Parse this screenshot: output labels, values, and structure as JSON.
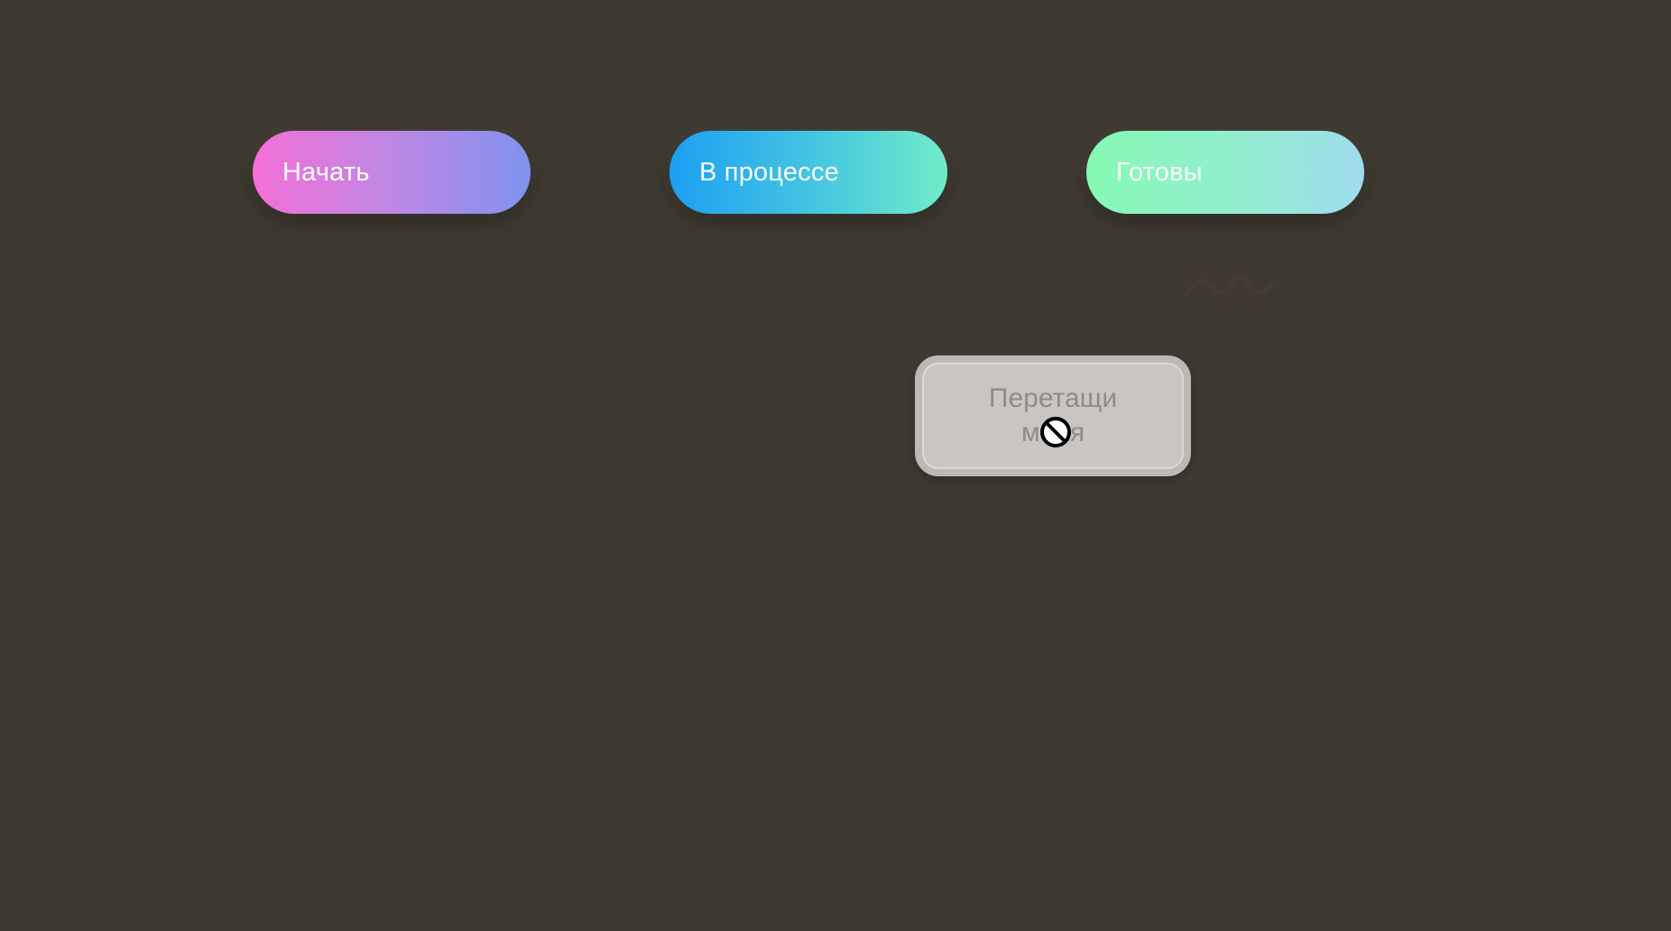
{
  "columns": [
    {
      "label": "Начать",
      "gradient_from": "#f46fd6",
      "gradient_to": "#7f93ee"
    },
    {
      "label": "В процессе",
      "gradient_from": "#1d9ff3",
      "gradient_to": "#70ecc9"
    },
    {
      "label": "Готовы",
      "gradient_from": "#86f9b3",
      "gradient_to": "#9fdcec"
    }
  ],
  "drag_card": {
    "label": "Перетащи меня"
  },
  "cursor": {
    "icon": "not-allowed-cursor-icon"
  },
  "colors": {
    "background": "#3f3a31",
    "card_fill": "#c9c6c2",
    "card_border": "#bdb8b3",
    "card_text": "#8c8c8c"
  }
}
